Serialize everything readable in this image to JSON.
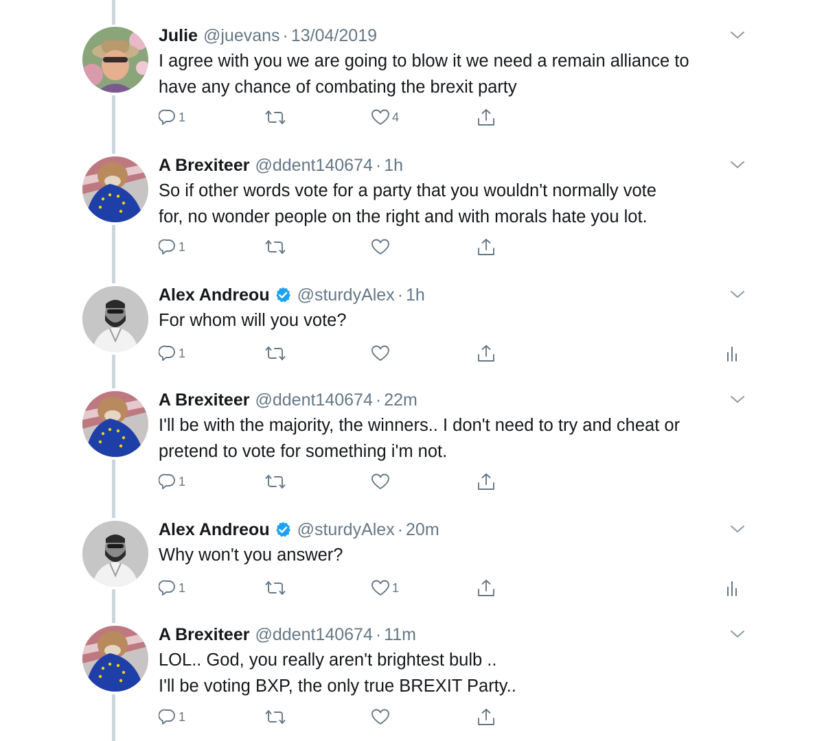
{
  "tweets": [
    {
      "author_name": "Julie",
      "handle": "@juevans",
      "separator": "·",
      "time": "13/04/2019",
      "verified": false,
      "avatar": "julie-avatar",
      "text_lines": [
        "I agree with you we are going to blow it we need a remain alliance to",
        "have any chance of combating the brexit party"
      ],
      "reply_count": "1",
      "retweet_count": "",
      "like_count": "4",
      "analytics": false
    },
    {
      "author_name": "A Brexiteer",
      "handle": "@ddent140674",
      "separator": "·",
      "time": "1h",
      "verified": false,
      "avatar": "brexiteer-avatar",
      "text_lines": [
        "So if other words vote for a party that you wouldn't normally vote",
        "for, no wonder people on the right and with morals hate you lot."
      ],
      "reply_count": "1",
      "retweet_count": "",
      "like_count": "",
      "analytics": false
    },
    {
      "author_name": "Alex Andreou",
      "handle": "@sturdyAlex",
      "separator": "·",
      "time": "1h",
      "verified": true,
      "avatar": "alex-avatar",
      "text_lines": [
        "For whom will you vote?"
      ],
      "reply_count": "1",
      "retweet_count": "",
      "like_count": "",
      "analytics": true
    },
    {
      "author_name": "A Brexiteer",
      "handle": "@ddent140674",
      "separator": "·",
      "time": "22m",
      "verified": false,
      "avatar": "brexiteer-avatar",
      "text_lines": [
        "I'll be with the majority, the winners.. I don't need to try and cheat or",
        "pretend to vote for something i'm not."
      ],
      "reply_count": "1",
      "retweet_count": "",
      "like_count": "",
      "analytics": false
    },
    {
      "author_name": "Alex Andreou",
      "handle": "@sturdyAlex",
      "separator": "·",
      "time": "20m",
      "verified": true,
      "avatar": "alex-avatar",
      "text_lines": [
        "Why won't you answer?"
      ],
      "reply_count": "1",
      "retweet_count": "",
      "like_count": "1",
      "analytics": true
    },
    {
      "author_name": "A Brexiteer",
      "handle": "@ddent140674",
      "separator": "·",
      "time": "11m",
      "verified": false,
      "avatar": "brexiteer-avatar",
      "text_lines": [
        "LOL.. God, you really aren't brightest bulb ..",
        "I'll be voting BXP, the only true BREXIT Party.."
      ],
      "reply_count": "1",
      "retweet_count": "",
      "like_count": "",
      "analytics": false
    }
  ],
  "icons": {
    "reply": "reply-icon",
    "retweet": "retweet-icon",
    "like": "like-icon",
    "share": "share-icon",
    "analytics": "analytics-icon",
    "more": "chevron-down-icon",
    "verified": "verified-badge-icon"
  },
  "colors": {
    "text": "#14171a",
    "secondary": "#657786",
    "thread_line": "#ccd6dd",
    "verified_blue": "#1da1f2",
    "background": "#ffffff"
  }
}
